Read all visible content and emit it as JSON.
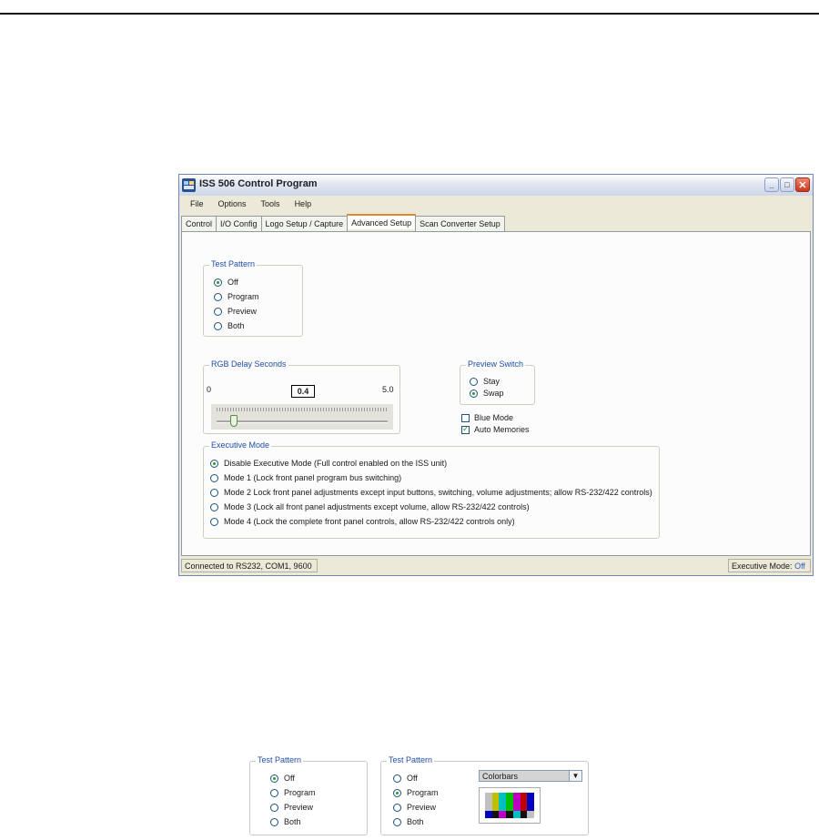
{
  "window": {
    "title": "ISS 506 Control Program",
    "menu": [
      "File",
      "Options",
      "Tools",
      "Help"
    ],
    "tabs": [
      "Control",
      "I/O Config",
      "Logo Setup / Capture",
      "Advanced Setup",
      "Scan Converter Setup"
    ],
    "active_tab": "Advanced Setup"
  },
  "test_pattern": {
    "legend": "Test Pattern",
    "options": [
      "Off",
      "Program",
      "Preview",
      "Both"
    ],
    "selected": "Off"
  },
  "rgb_delay": {
    "legend": "RGB Delay Seconds",
    "min": "0",
    "max": "5.0",
    "value": "0.4",
    "fraction": 0.08
  },
  "preview_switch": {
    "legend": "Preview Switch",
    "options": [
      "Stay",
      "Swap"
    ],
    "selected": "Swap"
  },
  "checkboxes": [
    {
      "label": "Blue Mode",
      "checked": false
    },
    {
      "label": "Auto Memories",
      "checked": true
    }
  ],
  "executive_mode": {
    "legend": "Executive Mode",
    "options": [
      "Disable Executive Mode (Full control enabled on the ISS unit)",
      "Mode 1 (Lock front panel program bus switching)",
      "Mode 2 Lock front panel adjustments except input buttons, switching, volume adjustments; allow RS-232/422 controls)",
      "Mode 3 (Lock all front panel adjustments except volume, allow RS-232/422 controls)",
      "Mode 4 (Lock the complete front panel controls, allow RS-232/422 controls only)"
    ],
    "selected": 0
  },
  "status": {
    "connection": "Connected to RS232, COM1, 9600",
    "exec_label": "Executive Mode:",
    "exec_value": "Off"
  },
  "examples": [
    {
      "legend": "Test Pattern",
      "options": [
        "Off",
        "Program",
        "Preview",
        "Both"
      ],
      "selected": "Off"
    },
    {
      "legend": "Test Pattern",
      "options": [
        "Off",
        "Program",
        "Preview",
        "Both"
      ],
      "selected": "Program",
      "pattern_select": "Colorbars"
    }
  ],
  "colors": {
    "legend_blue": "#1f4ea8",
    "radio_green": "#21a121",
    "tab_accent": "#e68b2c",
    "status_value_blue": "#2f5ec9",
    "colorbars_top": [
      "#c0c0c0",
      "#c0c000",
      "#00c0c0",
      "#00c000",
      "#c000c0",
      "#c00000",
      "#0000c0"
    ],
    "colorbars_bottom": [
      "#0000c0",
      "#111111",
      "#c000c0",
      "#111111",
      "#00c0c0",
      "#111111",
      "#c0c0c0"
    ]
  }
}
